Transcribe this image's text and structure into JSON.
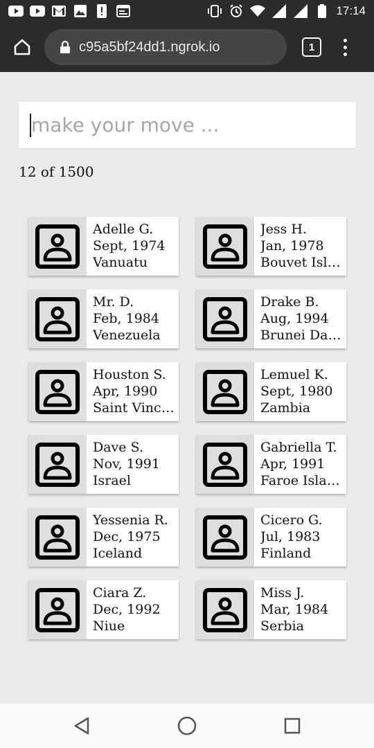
{
  "status_bar": {
    "time": "17:14",
    "left_icons": [
      "youtube-icon",
      "youtube-icon",
      "gmail-icon",
      "image-icon",
      "sim-alert-icon",
      "calendar-icon"
    ],
    "right_icons": [
      "vibrate-icon",
      "alarm-icon",
      "wifi-icon",
      "signal-icon",
      "signal-icon",
      "battery-icon"
    ]
  },
  "browser": {
    "url": "c95a5bf24dd1.ngrok.io",
    "tab_count": "1"
  },
  "search": {
    "placeholder": "make your move ..."
  },
  "results": {
    "count_text": "12 of 1500"
  },
  "people": [
    {
      "name": "Adelle G.",
      "date": "Sept, 1974",
      "country": "Vanuatu"
    },
    {
      "name": "Jess H.",
      "date": "Jan, 1978",
      "country": "Bouvet Island"
    },
    {
      "name": "Mr. D.",
      "date": "Feb, 1984",
      "country": "Venezuela"
    },
    {
      "name": "Drake B.",
      "date": "Aug, 1994",
      "country": "Brunei Darussalam"
    },
    {
      "name": "Houston S.",
      "date": "Apr, 1990",
      "country": "Saint Vincent and the Grenadines"
    },
    {
      "name": "Lemuel K.",
      "date": "Sept, 1980",
      "country": "Zambia"
    },
    {
      "name": "Dave S.",
      "date": "Nov, 1991",
      "country": "Israel"
    },
    {
      "name": "Gabriella T.",
      "date": "Apr, 1991",
      "country": "Faroe Islands"
    },
    {
      "name": "Yessenia R.",
      "date": "Dec, 1975",
      "country": "Iceland"
    },
    {
      "name": "Cicero G.",
      "date": "Jul, 1983",
      "country": "Finland"
    },
    {
      "name": "Ciara Z.",
      "date": "Dec, 1992",
      "country": "Niue"
    },
    {
      "name": "Miss J.",
      "date": "Mar, 1984",
      "country": "Serbia"
    }
  ],
  "nav": [
    "back-icon",
    "home-icon",
    "recents-icon"
  ],
  "colors": {
    "toolbar": "#2b2b2b",
    "url_pill": "#454545",
    "page_bg": "#ebebeb",
    "avatar_bg": "#dedede"
  }
}
